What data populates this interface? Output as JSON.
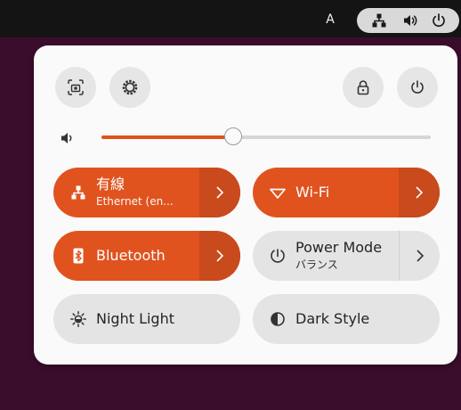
{
  "topbar": {
    "input_source": "A",
    "status_icons": [
      "network-wired-icon",
      "volume-icon",
      "power-icon"
    ]
  },
  "quick_settings": {
    "top_buttons": [
      "screenshot-icon",
      "settings-icon",
      "lock-icon",
      "power-icon"
    ],
    "volume": {
      "icon": "speaker-icon",
      "level": 0.4
    },
    "tiles": {
      "wired": {
        "title": "有線",
        "subtitle": "Ethernet (en...",
        "active": true,
        "icon": "network-wired-icon"
      },
      "wifi": {
        "title": "Wi-Fi",
        "active": true,
        "icon": "wifi-icon"
      },
      "bluetooth": {
        "title": "Bluetooth",
        "active": true,
        "icon": "bluetooth-icon"
      },
      "power_mode": {
        "title": "Power Mode",
        "subtitle": "バランス",
        "active": false,
        "icon": "power-mode-icon"
      },
      "night_light": {
        "title": "Night Light",
        "active": false,
        "icon": "night-light-icon"
      },
      "dark_style": {
        "title": "Dark Style",
        "active": false,
        "icon": "dark-style-icon"
      }
    }
  },
  "colors": {
    "accent": "#e0531f",
    "accent_dark": "#c94a1c",
    "panel_bg": "#fafafa",
    "tile_off": "#e4e4e4",
    "desktop_bg": "#3b0d2c",
    "topbar_bg": "#141414"
  }
}
